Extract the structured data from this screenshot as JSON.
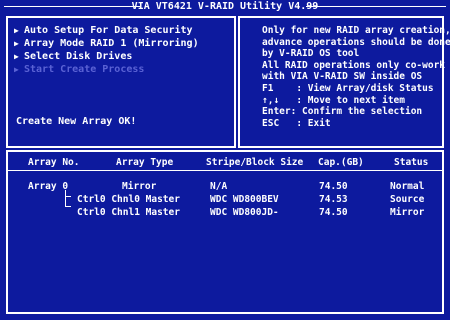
{
  "title": "VIA VT6421 V-RAID Utility V4.99",
  "menu": {
    "items": [
      {
        "label": "Auto Setup For Data Security",
        "enabled": true
      },
      {
        "label": "Array Mode RAID 1 (Mirroring)",
        "enabled": true
      },
      {
        "label": "Select Disk Drives",
        "enabled": true
      },
      {
        "label": "Start Create Process",
        "enabled": false
      }
    ]
  },
  "status_message": "Create New Array OK!",
  "help": {
    "lines": [
      "Only for new RAID array creation,",
      "advance operations should be done",
      "by V-RAID OS tool",
      "All RAID operations only co-work",
      "with VIA V-RAID SW inside OS",
      "F1    : View Array/disk Status",
      "↑,↓   : Move to next item",
      "Enter: Confirm the selection",
      "ESC   : Exit"
    ]
  },
  "table": {
    "headers": {
      "array_no": "Array No.",
      "array_type": "Array Type",
      "stripe": "Stripe/Block Size",
      "cap": "Cap.(GB)",
      "status": "Status"
    },
    "rows": [
      {
        "array_no": "Array 0",
        "array_type": "Mirror",
        "stripe": "N/A",
        "cap": "74.50",
        "status": "Normal"
      },
      {
        "array_no": "",
        "array_type": "Ctrl0 Chnl0 Master",
        "stripe": "WDC WD800BEV",
        "cap": "74.53",
        "status": "Source"
      },
      {
        "array_no": "",
        "array_type": "Ctrl0 Chnl1 Master",
        "stripe": "WDC WD800JD-",
        "cap": "74.50",
        "status": "Mirror"
      }
    ]
  },
  "colors": {
    "background": "#0d1a9e",
    "text": "#ffffff",
    "disabled_text": "#5a62d4"
  },
  "icons": {
    "menu_marker": "triangle-right-icon"
  }
}
